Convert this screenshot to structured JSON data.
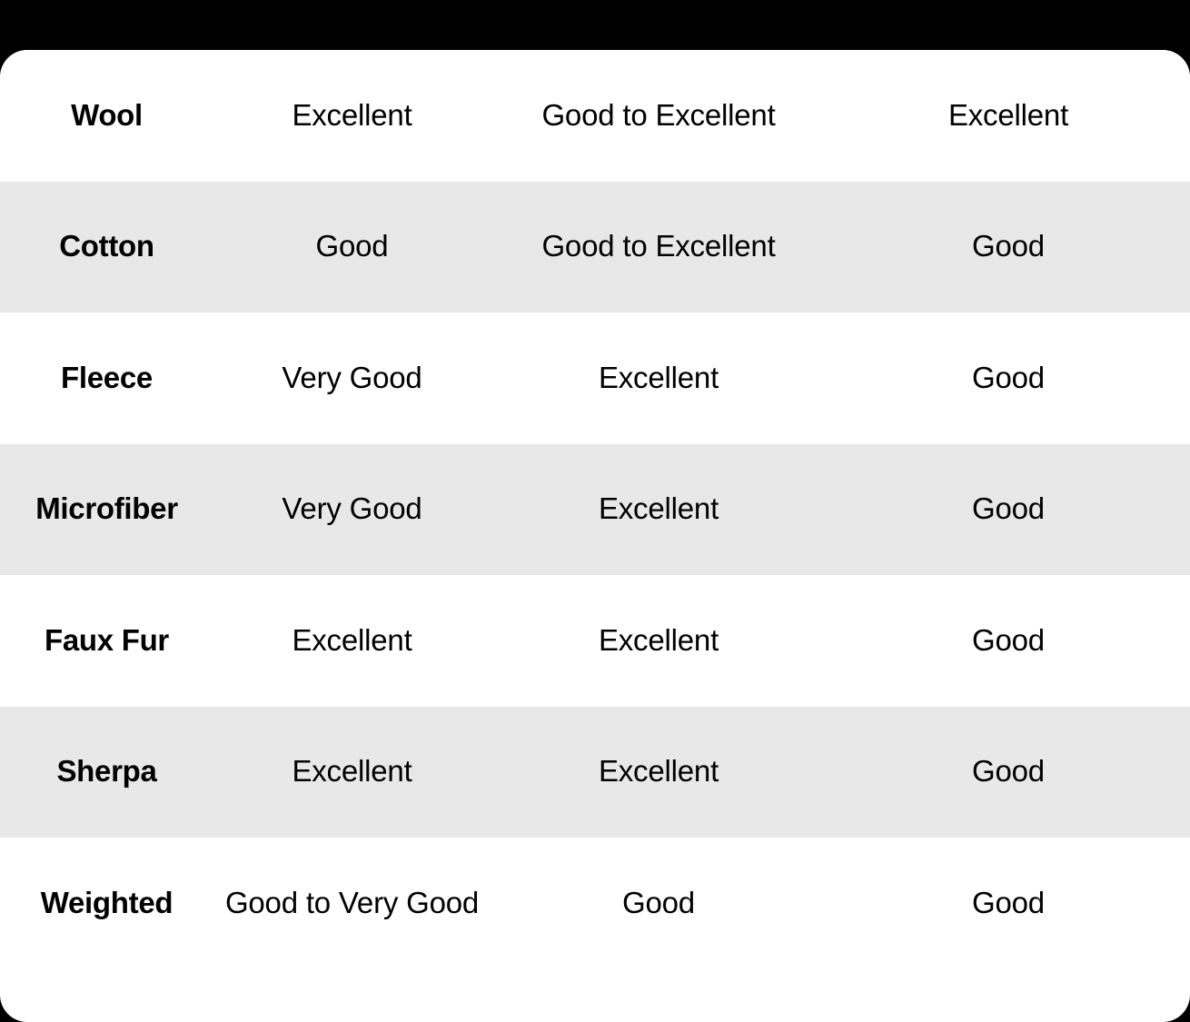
{
  "card": {
    "background_color": "#ffffff",
    "page_background_color": "#000000",
    "shaded_row_color": "#e8e8e8",
    "text_color": "#000000",
    "corner_radius_px": 30
  },
  "table": {
    "columns": [
      {
        "key": "material",
        "name": "material-column"
      },
      {
        "key": "warmth",
        "name": "warmth-column"
      },
      {
        "key": "softness",
        "name": "softness-column"
      },
      {
        "key": "durability",
        "name": "durability-column"
      }
    ],
    "rows": [
      {
        "shaded": false,
        "material": "Wool",
        "warmth": "Excellent",
        "softness": "Good to Excellent",
        "durability": "Excellent"
      },
      {
        "shaded": true,
        "material": "Cotton",
        "warmth": "Good",
        "softness": "Good to Excellent",
        "durability": "Good"
      },
      {
        "shaded": false,
        "material": "Fleece",
        "warmth": "Very Good",
        "softness": "Excellent",
        "durability": "Good"
      },
      {
        "shaded": true,
        "material": "Microfiber",
        "warmth": "Very Good",
        "softness": "Excellent",
        "durability": "Good"
      },
      {
        "shaded": false,
        "material": "Faux Fur",
        "warmth": "Excellent",
        "softness": "Excellent",
        "durability": "Good"
      },
      {
        "shaded": true,
        "material": "Sherpa",
        "warmth": "Excellent",
        "softness": "Excellent",
        "durability": "Good"
      },
      {
        "shaded": false,
        "material": "Weighted",
        "warmth": "Good to Very Good",
        "softness": "Good",
        "durability": "Good"
      }
    ]
  }
}
